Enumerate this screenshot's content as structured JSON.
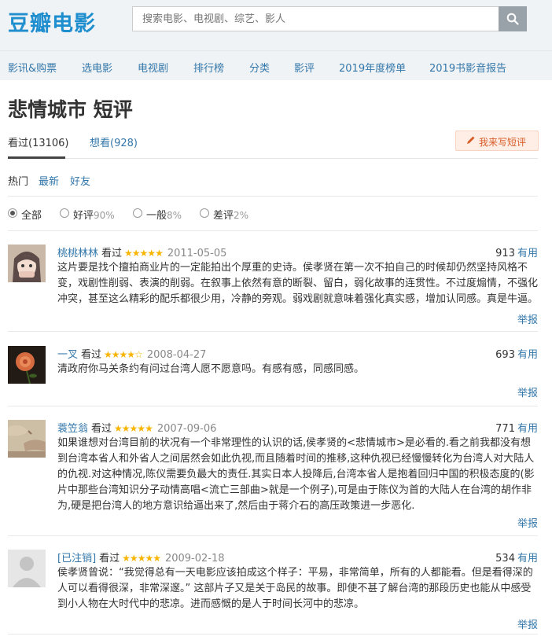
{
  "header": {
    "logo": "豆瓣电影",
    "search_placeholder": "搜索电影、电视剧、综艺、影人"
  },
  "nav": [
    "影讯&购票",
    "选电影",
    "电视剧",
    "排行榜",
    "分类",
    "影评",
    "2019年度榜单",
    "2019书影音报告"
  ],
  "page": {
    "title": "悲情城市 短评",
    "tab_watched": "看过(13106)",
    "tab_want": "想看(928)",
    "write_label": "我来写短评",
    "sort": [
      "热门",
      "最新",
      "好友"
    ],
    "filters": [
      {
        "label": "全部",
        "pct": "",
        "checked": true
      },
      {
        "label": "好评",
        "pct": "90%",
        "checked": false
      },
      {
        "label": "一般",
        "pct": "8%",
        "checked": false
      },
      {
        "label": "差评",
        "pct": "2%",
        "checked": false
      }
    ]
  },
  "comments": [
    {
      "user": "桃桃林林",
      "status": "看过",
      "stars": "★★★★★",
      "date": "2011-05-05",
      "votes": "913",
      "useful": "有用",
      "text": "这片要是找个擅拍商业片的一定能拍出个厚重的史诗。侯孝贤在第一次不拍自己的时候却仍然坚持风格不变，戏剧性削弱、表演的削弱。在叙事上依然有意的断裂、留白，弱化故事的连贯性。不过度煽情，不强化冲突，甚至这么精彩的配乐都很少用，冷静的旁观。弱戏剧就意味着强化真实感，增加认同感。真是牛逼。",
      "report": "举报",
      "avatar": "anime-girl-avatar"
    },
    {
      "user": "一叉",
      "status": "看过",
      "stars": "★★★★☆",
      "date": "2008-04-27",
      "votes": "693",
      "useful": "有用",
      "text": "清政府你马关条约有问过台湾人愿不愿意吗。有感有感，同感同感。",
      "report": "举报",
      "avatar": "rose-avatar"
    },
    {
      "user": "蓑笠翁",
      "status": "看过",
      "stars": "★★★★★",
      "date": "2007-09-06",
      "votes": "771",
      "useful": "有用",
      "text": "如果谁想对台湾目前的状况有一个非常理性的认识的话,侯孝贤的<悲情城市>是必看的.看之前我都没有想到台湾本省人和外省人之间居然会如此仇视,而且随着时间的推移,这种仇视已经慢慢转化为台湾人对大陆人的仇视.对这种情况,陈仪需要负最大的责任.其实日本人投降后,台湾本省人是抱着回归中国的积极态度的(影片中那些台湾知识分子动情高唱<流亡三部曲>就是一个例子),可是由于陈仪为首的大陆人在台湾的胡作非为,硬是把台湾人的地方意识给逼出来了,然后由于蒋介石的高压政策进一步恶化.",
      "report": "举报",
      "avatar": "painting-avatar"
    },
    {
      "user": "[已注销]",
      "status": "看过",
      "stars": "★★★★★",
      "date": "2009-02-18",
      "votes": "534",
      "useful": "有用",
      "text": "侯孝贤曾说：“我觉得总有一天电影应该拍成这个样子：平易，非常简单，所有的人都能看。但是看得深的人可以看得很深，非常深邃。” 这部片子又是关于岛民的故事。即使不甚了解台湾的那段历史也能从中感受到小人物在大时代中的悲凉。进而感慨的是人于时间长河中的悲凉。",
      "report": "举报",
      "avatar": "default-user-avatar"
    }
  ],
  "colors": {
    "link": "#3377aa",
    "star": "#f7b500",
    "logo": "#1f8ecf",
    "write_btn": "#d65c28"
  }
}
